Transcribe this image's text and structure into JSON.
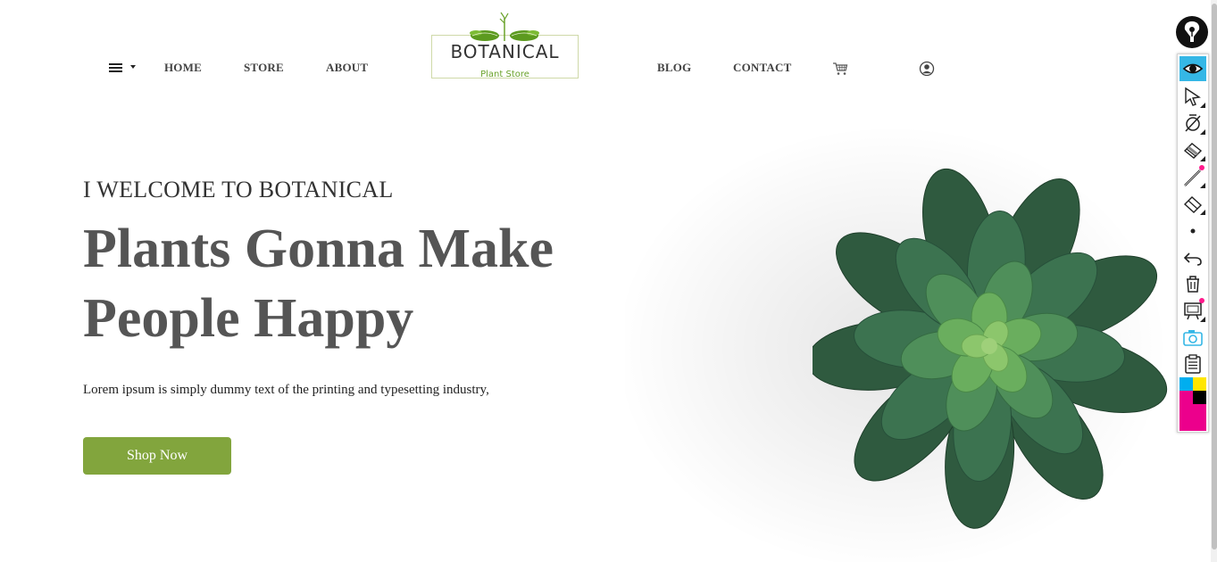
{
  "nav": {
    "menu_icon": "hamburger-icon",
    "links": [
      "HOME",
      "STORE",
      "ABOUT",
      "BLOG",
      "CONTACT"
    ],
    "cart_icon": "cart-icon",
    "user_icon": "user-icon"
  },
  "logo": {
    "title": "BOTANICAL",
    "subtitle": "Plant Store"
  },
  "hero": {
    "eyebrow": "I WELCOME TO BOTANICAL",
    "headline_line1": "Plants Gonna Make",
    "headline_line2": "People Happy",
    "description": "Lorem ipsum is simply dummy text of the printing and typesetting industry,",
    "cta_label": "Shop Now",
    "image": "succulent-plant-image"
  },
  "toolbar": {
    "logo_icon": "pen-nib-icon",
    "tools": [
      "eye-icon",
      "cursor-icon",
      "shape-icon",
      "eraser-icon",
      "pen-icon",
      "highlighter-icon",
      "dot-size-icon",
      "undo-icon",
      "trash-icon",
      "screen-capture-icon",
      "camera-icon",
      "clipboard-icon",
      "color-palette"
    ],
    "active_tool": "eye-icon"
  },
  "colors": {
    "accent_green": "#82a53d",
    "logo_green": "#6aa22b",
    "headline_gray": "#555555",
    "toolbar_active": "#35b7e6",
    "toolbar_pink": "#ec008c"
  }
}
